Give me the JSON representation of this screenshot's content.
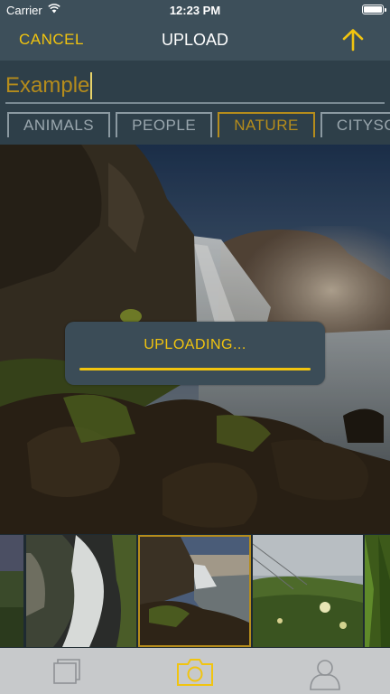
{
  "status_bar": {
    "carrier": "Carrier",
    "time": "12:23 PM"
  },
  "nav": {
    "cancel_label": "CANCEL",
    "title": "UPLOAD",
    "upload_icon": "arrow-up-icon"
  },
  "form": {
    "title_value": "Example",
    "categories": [
      {
        "label": "ANIMALS",
        "selected": false
      },
      {
        "label": "PEOPLE",
        "selected": false
      },
      {
        "label": "NATURE",
        "selected": true
      },
      {
        "label": "CITYSCAPES",
        "selected": false
      }
    ]
  },
  "upload_dialog": {
    "message": "UPLOADING...",
    "progress": 1.0
  },
  "thumbnails": [
    {
      "name": "partial-image",
      "selected": false
    },
    {
      "name": "waterfall-closeup",
      "selected": false
    },
    {
      "name": "waterfall-coast",
      "selected": true
    },
    {
      "name": "wildflowers-meadow",
      "selected": false
    },
    {
      "name": "green-grass",
      "selected": false
    }
  ],
  "tab_bar": {
    "tabs": [
      {
        "icon": "gallery-icon",
        "active": false
      },
      {
        "icon": "camera-icon",
        "active": true
      },
      {
        "icon": "profile-icon",
        "active": false
      }
    ]
  },
  "colors": {
    "accent": "#f1c40f",
    "accent_dark": "#b58c1c",
    "bar": "#3d4f5a"
  }
}
